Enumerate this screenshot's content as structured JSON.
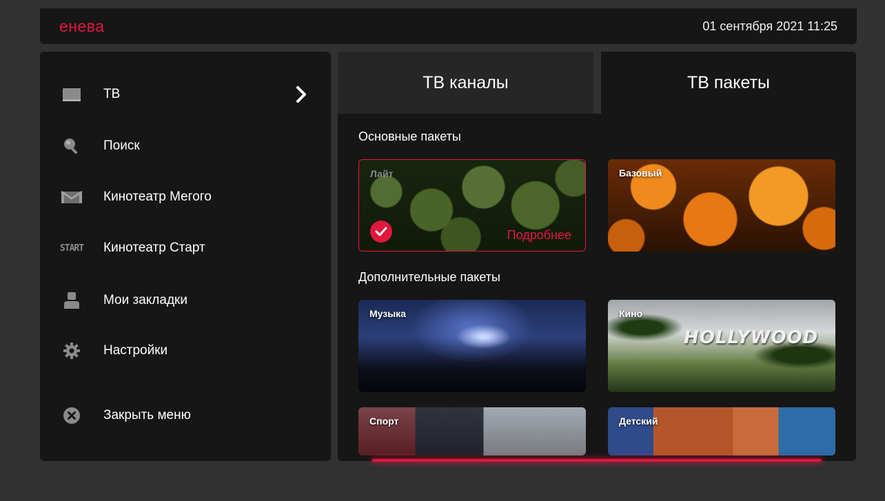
{
  "header": {
    "logo": "енева",
    "datetime": "01 сентября 2021  11:25"
  },
  "sidebar": {
    "items": [
      {
        "label": "ТВ",
        "icon": "tv-icon"
      },
      {
        "label": "Поиск",
        "icon": "search-icon"
      },
      {
        "label": "Кинотеатр Мегого",
        "icon": "megogo-icon"
      },
      {
        "label": "Кинотеатр Старт",
        "icon": "start-icon",
        "icon_text": "START"
      },
      {
        "label": "Мои закладки",
        "icon": "user-icon"
      },
      {
        "label": "Настройки",
        "icon": "gear-icon"
      },
      {
        "label": "Закрыть меню",
        "icon": "close-icon"
      }
    ]
  },
  "tabs": [
    {
      "label": "ТВ каналы"
    },
    {
      "label": "ТВ пакеты"
    }
  ],
  "main_packages": {
    "title": "Основные пакеты",
    "cards": [
      {
        "title": "Лайт",
        "more_label": "Подробнее",
        "selected": true
      },
      {
        "title": "Базовый"
      }
    ]
  },
  "extra_packages": {
    "title": "Дополнительные пакеты",
    "cards": [
      {
        "title": "Музыка"
      },
      {
        "title": "Кино",
        "image_text": "HOLLYWOOD"
      },
      {
        "title": "Спорт"
      },
      {
        "title": "Детский"
      }
    ]
  },
  "colors": {
    "accent": "#e2173f",
    "panel": "#161616",
    "background": "#313131"
  }
}
